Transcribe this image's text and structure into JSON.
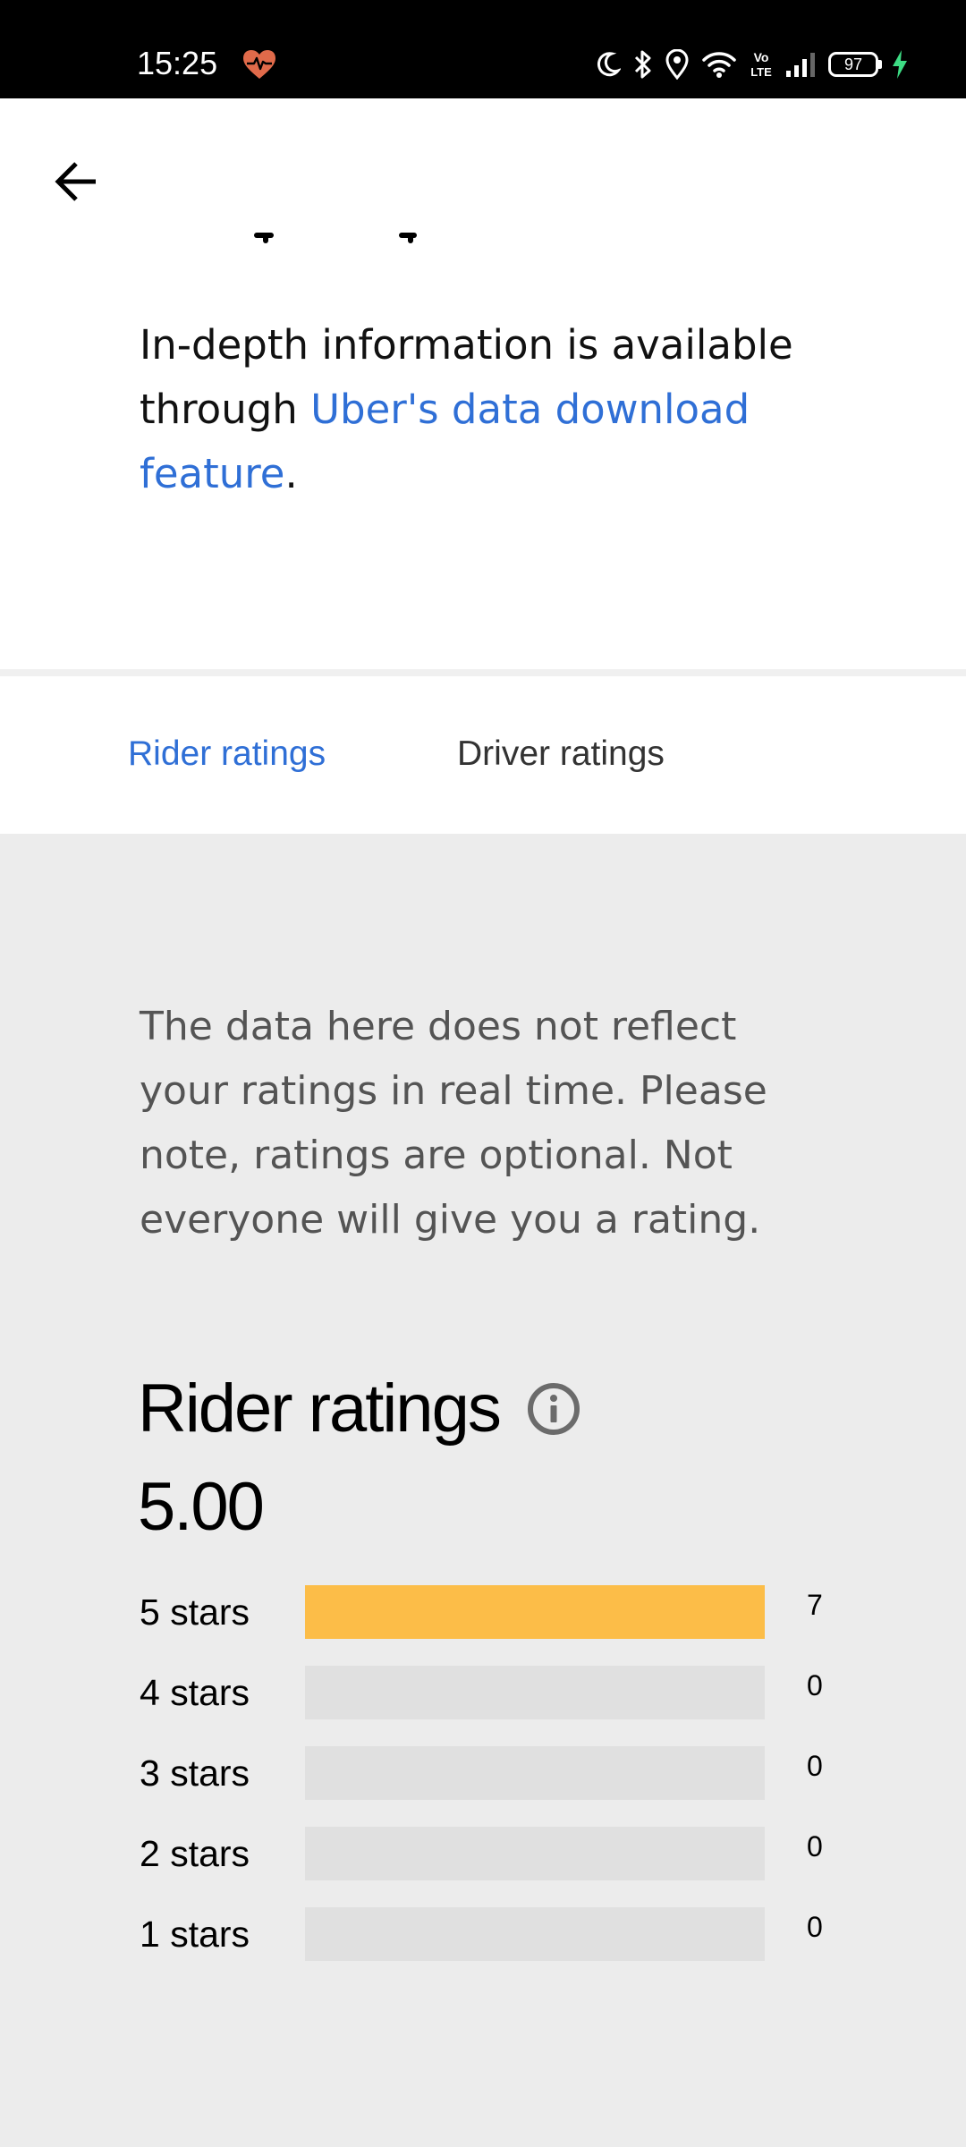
{
  "status_bar": {
    "time": "15:25",
    "battery_level": "97",
    "icons": [
      "heart-monitor-icon",
      "moon-icon",
      "bluetooth-icon",
      "location-icon",
      "wifi-icon",
      "volte-icon",
      "signal-icon",
      "battery-icon",
      "charging-icon"
    ],
    "heart_color": "#e06a4a",
    "charging_color": "#3ddc84"
  },
  "header": {
    "back_icon": "arrow-left-icon"
  },
  "info": {
    "text_before": "In-depth information is available through ",
    "link_text": "Uber's data download feature",
    "text_after": "."
  },
  "tabs": {
    "rider": "Rider ratings",
    "driver": "Driver ratings",
    "active": "rider",
    "active_color": "#2f6fd6"
  },
  "notice": "The data here does not reflect your ratings in real time. Please note, ratings are optional. Not everyone will give you a rating.",
  "ratings": {
    "title": "Rider ratings",
    "info_icon": "info-circle-icon",
    "average": "5.00",
    "bar_color": "#fcbd48",
    "rows": [
      {
        "label": "5 stars",
        "count": "7",
        "fraction": 1.0
      },
      {
        "label": "4 stars",
        "count": "0",
        "fraction": 0
      },
      {
        "label": "3 stars",
        "count": "0",
        "fraction": 0
      },
      {
        "label": "2 stars",
        "count": "0",
        "fraction": 0
      },
      {
        "label": "1 stars",
        "count": "0",
        "fraction": 0
      }
    ]
  }
}
